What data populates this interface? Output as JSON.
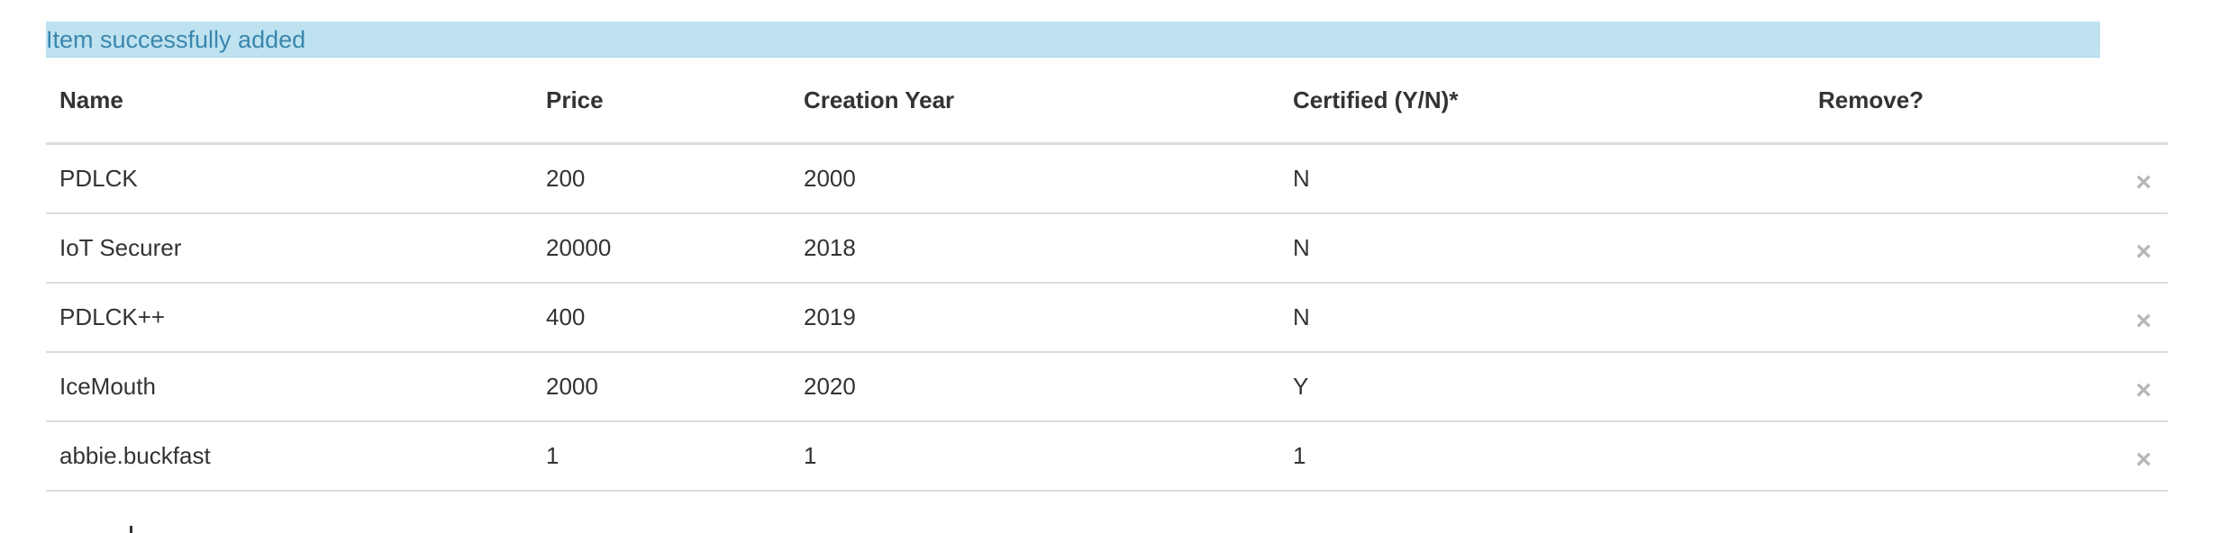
{
  "alert": {
    "message": "Item successfully added",
    "color": "#bfe2f1"
  },
  "table": {
    "headers": {
      "name": "Name",
      "price": "Price",
      "year": "Creation Year",
      "certified": "Certified (Y/N)*",
      "remove": "Remove?"
    },
    "rows": [
      {
        "name": "PDLCK",
        "price": "200",
        "year": "2000",
        "certified": "N",
        "remove_icon": "×"
      },
      {
        "name": "IoT Securer",
        "price": "20000",
        "year": "2018",
        "certified": "N",
        "remove_icon": "×"
      },
      {
        "name": "PDLCK++",
        "price": "400",
        "year": "2019",
        "certified": "N",
        "remove_icon": "×"
      },
      {
        "name": "IceMouth",
        "price": "2000",
        "year": "2020",
        "certified": "Y",
        "remove_icon": "×"
      },
      {
        "name": "abbie.buckfast",
        "price": "1",
        "year": "1",
        "certified": "1",
        "remove_icon": "×"
      }
    ]
  }
}
